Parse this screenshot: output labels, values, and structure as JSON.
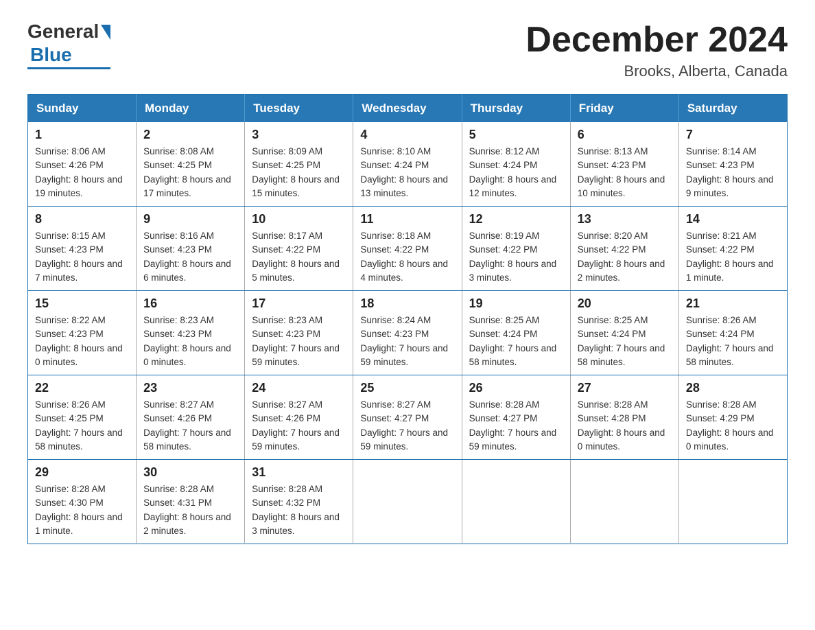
{
  "logo": {
    "general": "General",
    "blue": "Blue"
  },
  "title": {
    "month_year": "December 2024",
    "location": "Brooks, Alberta, Canada"
  },
  "days_of_week": [
    "Sunday",
    "Monday",
    "Tuesday",
    "Wednesday",
    "Thursday",
    "Friday",
    "Saturday"
  ],
  "weeks": [
    [
      {
        "day": "1",
        "sunrise": "8:06 AM",
        "sunset": "4:26 PM",
        "daylight": "8 hours and 19 minutes."
      },
      {
        "day": "2",
        "sunrise": "8:08 AM",
        "sunset": "4:25 PM",
        "daylight": "8 hours and 17 minutes."
      },
      {
        "day": "3",
        "sunrise": "8:09 AM",
        "sunset": "4:25 PM",
        "daylight": "8 hours and 15 minutes."
      },
      {
        "day": "4",
        "sunrise": "8:10 AM",
        "sunset": "4:24 PM",
        "daylight": "8 hours and 13 minutes."
      },
      {
        "day": "5",
        "sunrise": "8:12 AM",
        "sunset": "4:24 PM",
        "daylight": "8 hours and 12 minutes."
      },
      {
        "day": "6",
        "sunrise": "8:13 AM",
        "sunset": "4:23 PM",
        "daylight": "8 hours and 10 minutes."
      },
      {
        "day": "7",
        "sunrise": "8:14 AM",
        "sunset": "4:23 PM",
        "daylight": "8 hours and 9 minutes."
      }
    ],
    [
      {
        "day": "8",
        "sunrise": "8:15 AM",
        "sunset": "4:23 PM",
        "daylight": "8 hours and 7 minutes."
      },
      {
        "day": "9",
        "sunrise": "8:16 AM",
        "sunset": "4:23 PM",
        "daylight": "8 hours and 6 minutes."
      },
      {
        "day": "10",
        "sunrise": "8:17 AM",
        "sunset": "4:22 PM",
        "daylight": "8 hours and 5 minutes."
      },
      {
        "day": "11",
        "sunrise": "8:18 AM",
        "sunset": "4:22 PM",
        "daylight": "8 hours and 4 minutes."
      },
      {
        "day": "12",
        "sunrise": "8:19 AM",
        "sunset": "4:22 PM",
        "daylight": "8 hours and 3 minutes."
      },
      {
        "day": "13",
        "sunrise": "8:20 AM",
        "sunset": "4:22 PM",
        "daylight": "8 hours and 2 minutes."
      },
      {
        "day": "14",
        "sunrise": "8:21 AM",
        "sunset": "4:22 PM",
        "daylight": "8 hours and 1 minute."
      }
    ],
    [
      {
        "day": "15",
        "sunrise": "8:22 AM",
        "sunset": "4:23 PM",
        "daylight": "8 hours and 0 minutes."
      },
      {
        "day": "16",
        "sunrise": "8:23 AM",
        "sunset": "4:23 PM",
        "daylight": "8 hours and 0 minutes."
      },
      {
        "day": "17",
        "sunrise": "8:23 AM",
        "sunset": "4:23 PM",
        "daylight": "7 hours and 59 minutes."
      },
      {
        "day": "18",
        "sunrise": "8:24 AM",
        "sunset": "4:23 PM",
        "daylight": "7 hours and 59 minutes."
      },
      {
        "day": "19",
        "sunrise": "8:25 AM",
        "sunset": "4:24 PM",
        "daylight": "7 hours and 58 minutes."
      },
      {
        "day": "20",
        "sunrise": "8:25 AM",
        "sunset": "4:24 PM",
        "daylight": "7 hours and 58 minutes."
      },
      {
        "day": "21",
        "sunrise": "8:26 AM",
        "sunset": "4:24 PM",
        "daylight": "7 hours and 58 minutes."
      }
    ],
    [
      {
        "day": "22",
        "sunrise": "8:26 AM",
        "sunset": "4:25 PM",
        "daylight": "7 hours and 58 minutes."
      },
      {
        "day": "23",
        "sunrise": "8:27 AM",
        "sunset": "4:26 PM",
        "daylight": "7 hours and 58 minutes."
      },
      {
        "day": "24",
        "sunrise": "8:27 AM",
        "sunset": "4:26 PM",
        "daylight": "7 hours and 59 minutes."
      },
      {
        "day": "25",
        "sunrise": "8:27 AM",
        "sunset": "4:27 PM",
        "daylight": "7 hours and 59 minutes."
      },
      {
        "day": "26",
        "sunrise": "8:28 AM",
        "sunset": "4:27 PM",
        "daylight": "7 hours and 59 minutes."
      },
      {
        "day": "27",
        "sunrise": "8:28 AM",
        "sunset": "4:28 PM",
        "daylight": "8 hours and 0 minutes."
      },
      {
        "day": "28",
        "sunrise": "8:28 AM",
        "sunset": "4:29 PM",
        "daylight": "8 hours and 0 minutes."
      }
    ],
    [
      {
        "day": "29",
        "sunrise": "8:28 AM",
        "sunset": "4:30 PM",
        "daylight": "8 hours and 1 minute."
      },
      {
        "day": "30",
        "sunrise": "8:28 AM",
        "sunset": "4:31 PM",
        "daylight": "8 hours and 2 minutes."
      },
      {
        "day": "31",
        "sunrise": "8:28 AM",
        "sunset": "4:32 PM",
        "daylight": "8 hours and 3 minutes."
      },
      null,
      null,
      null,
      null
    ]
  ],
  "labels": {
    "sunrise": "Sunrise:",
    "sunset": "Sunset:",
    "daylight": "Daylight:"
  }
}
